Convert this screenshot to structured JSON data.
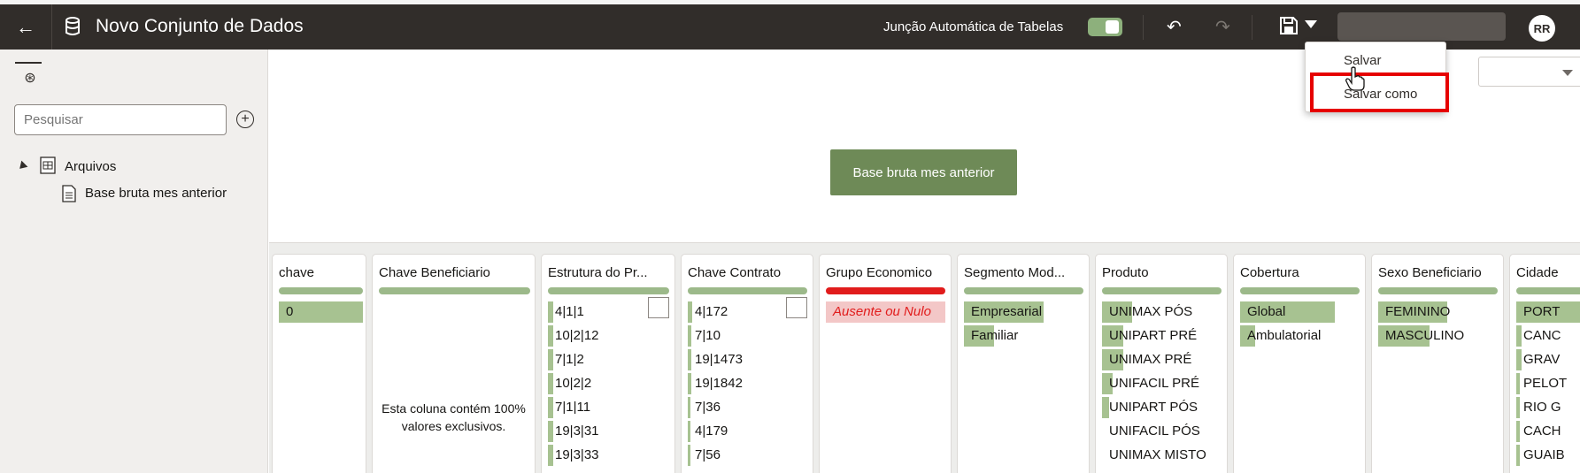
{
  "header": {
    "title": "Novo Conjunto de Dados",
    "auto_join_label": "Junção Automática de Tabelas",
    "auto_join_on": true,
    "avatar_initials": "RR",
    "icons": [
      "back-arrow-icon",
      "database-icon",
      "undo-icon",
      "redo-icon",
      "save-icon",
      "chevron-down-icon"
    ]
  },
  "save_menu": {
    "items": [
      "Salvar",
      "Salvar como"
    ]
  },
  "left_panel": {
    "search_placeholder": "Pesquisar",
    "tree": {
      "folder": "Arquivos",
      "file": "Base bruta mes anterior"
    }
  },
  "diagram": {
    "node_label": "Base bruta mes anterior"
  },
  "columns": [
    {
      "name": "chave",
      "values": [
        "0"
      ]
    },
    {
      "name": "Chave Beneficiario",
      "values": [],
      "message": "Esta coluna contém 100% valores exclusivos."
    },
    {
      "name": "Estrutura do Pr...",
      "values": [
        "4|1|1",
        "10|2|12",
        "7|1|2",
        "10|2|2",
        "7|1|11",
        "19|3|31",
        "19|3|33"
      ]
    },
    {
      "name": "Chave Contrato",
      "values": [
        "4|172",
        "7|10",
        "19|1473",
        "19|1842",
        "7|36",
        "4|179",
        "7|56"
      ]
    },
    {
      "name": "Grupo Economico",
      "values": [
        "Ausente ou Nulo"
      ],
      "quality": "missing"
    },
    {
      "name": "Segmento Mod...",
      "values": [
        "Empresarial",
        "Familiar"
      ]
    },
    {
      "name": "Produto",
      "values": [
        "UNIMAX PÓS",
        "UNIPART PRÉ",
        "UNIMAX PRÉ",
        "UNIFACIL PRÉ",
        "UNIPART PÓS",
        "UNIFACIL PÓS",
        "UNIMAX MISTO"
      ]
    },
    {
      "name": "Cobertura",
      "values": [
        "Global",
        "Ambulatorial"
      ]
    },
    {
      "name": "Sexo Beneficiario",
      "values": [
        "FEMININO",
        "MASCULINO"
      ]
    },
    {
      "name": "Cidade",
      "values": [
        "PORT",
        "CANC",
        "GRAV",
        "PELOT",
        "RIO G",
        "CACH",
        "GUAIB"
      ]
    }
  ],
  "colors": {
    "header_bg": "#312d2a",
    "accent_green": "#6e8a57",
    "value_bar": "#a7c291",
    "missing_red": "#e11c1c",
    "highlight_red": "#e60000"
  }
}
